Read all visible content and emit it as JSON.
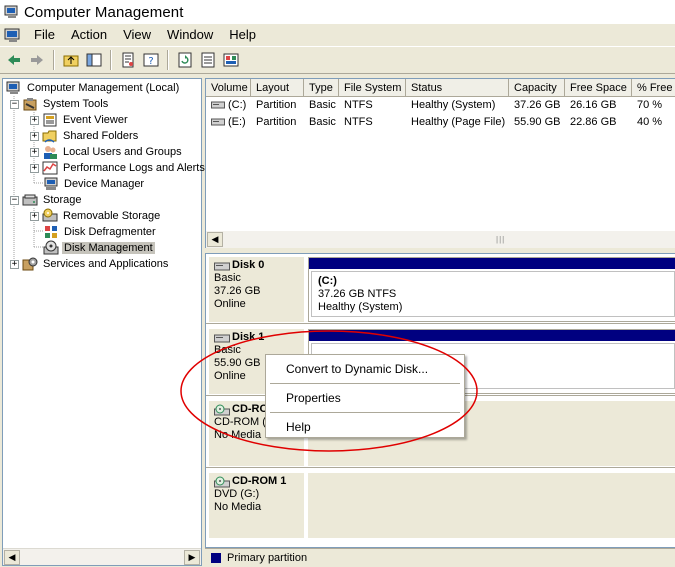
{
  "window": {
    "title": "Computer Management"
  },
  "menubar": {
    "items": [
      "File",
      "Action",
      "View",
      "Window",
      "Help"
    ]
  },
  "toolbar": {
    "icons": [
      "back-icon",
      "forward-icon",
      "up-folder-icon",
      "show-hide-tree-icon",
      "properties-icon",
      "help-icon",
      "refresh-icon",
      "export-list-icon",
      "console-icon"
    ]
  },
  "tree": {
    "items": [
      {
        "label": "Computer Management (Local)",
        "icon": "computer-icon",
        "expander": "−",
        "level": 0
      },
      {
        "label": "System Tools",
        "icon": "tools-icon",
        "expander": "−",
        "level": 1
      },
      {
        "label": "Event Viewer",
        "icon": "event-viewer-icon",
        "expander": "+",
        "level": 2
      },
      {
        "label": "Shared Folders",
        "icon": "shared-folder-icon",
        "expander": "+",
        "level": 2
      },
      {
        "label": "Local Users and Groups",
        "icon": "users-icon",
        "expander": "+",
        "level": 2
      },
      {
        "label": "Performance Logs and Alerts",
        "icon": "performance-icon",
        "expander": "+",
        "level": 2
      },
      {
        "label": "Device Manager",
        "icon": "device-manager-icon",
        "expander": "",
        "level": 2
      },
      {
        "label": "Storage",
        "icon": "storage-icon",
        "expander": "−",
        "level": 1
      },
      {
        "label": "Removable Storage",
        "icon": "removable-storage-icon",
        "expander": "+",
        "level": 2
      },
      {
        "label": "Disk Defragmenter",
        "icon": "defrag-icon",
        "expander": "",
        "level": 2
      },
      {
        "label": "Disk Management",
        "icon": "disk-management-icon",
        "expander": "",
        "level": 2,
        "selected": true
      },
      {
        "label": "Services and Applications",
        "icon": "services-icon",
        "expander": "+",
        "level": 1
      }
    ]
  },
  "volumes": {
    "columns": [
      "Volume",
      "Layout",
      "Type",
      "File System",
      "Status",
      "Capacity",
      "Free Space",
      "% Free"
    ],
    "rows": [
      [
        "(C:)",
        "Partition",
        "Basic",
        "NTFS",
        "Healthy (System)",
        "37.26 GB",
        "26.16 GB",
        "70 %"
      ],
      [
        "(E:)",
        "Partition",
        "Basic",
        "NTFS",
        "Healthy (Page File)",
        "55.90 GB",
        "22.86 GB",
        "40 %"
      ]
    ]
  },
  "disks": [
    {
      "name": "Disk 0",
      "type": "Basic",
      "size": "37.26 GB",
      "state": "Online",
      "volume": {
        "letter": "(C:)",
        "detail": "37.26 GB NTFS",
        "status": "Healthy (System)"
      }
    },
    {
      "name": "Disk 1",
      "type": "Basic",
      "size": "55.90 GB",
      "state": "Online"
    },
    {
      "name": "CD-ROM 0",
      "type": "CD-ROM (F:)",
      "size": "",
      "state": "No Media"
    },
    {
      "name": "CD-ROM 1",
      "type": "DVD (G:)",
      "size": "",
      "state": "No Media"
    }
  ],
  "legend": {
    "primary": "Primary partition"
  },
  "context_menu": {
    "items": [
      "Convert to Dynamic Disk...",
      "Properties",
      "Help"
    ]
  },
  "colors": {
    "primary_partition": "#000080",
    "annotation": "#e00000",
    "selection": "#c5c3bb"
  }
}
